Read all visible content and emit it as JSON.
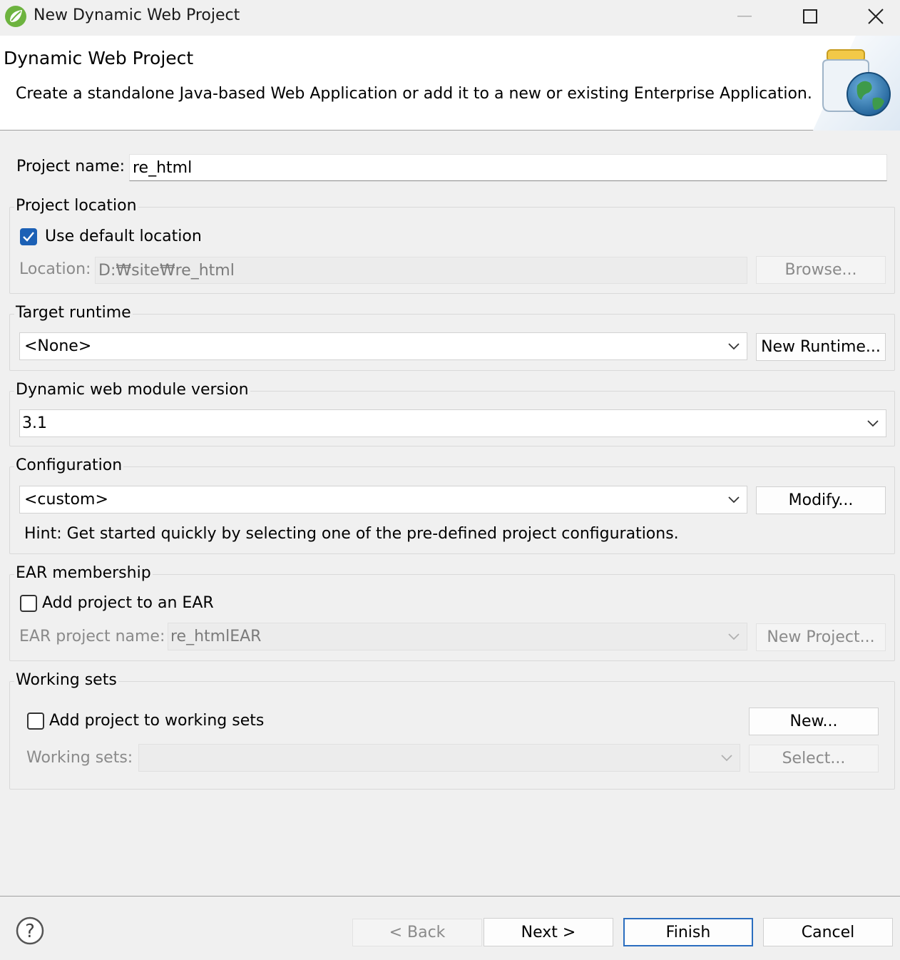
{
  "window": {
    "title": "New Dynamic Web Project",
    "minimize_icon": "minimize-icon",
    "maximize_icon": "maximize-icon",
    "close_icon": "close-icon"
  },
  "banner": {
    "title": "Dynamic Web Project",
    "description": "Create a standalone Java-based Web Application or add it to a new or existing Enterprise Application.",
    "image_icon": "jar-globe-icon"
  },
  "project_name": {
    "label": "Project name:",
    "value": "re_html"
  },
  "project_location": {
    "legend": "Project location",
    "use_default_label": "Use default location",
    "use_default_checked": true,
    "location_label": "Location:",
    "location_value": "D:₩site₩re_html",
    "browse_label": "Browse..."
  },
  "target_runtime": {
    "legend": "Target runtime",
    "selected": "<None>",
    "new_runtime_label": "New Runtime..."
  },
  "module_version": {
    "legend": "Dynamic web module version",
    "selected": "3.1"
  },
  "configuration": {
    "legend": "Configuration",
    "selected": "<custom>",
    "modify_label": "Modify...",
    "hint": "Hint: Get started quickly by selecting one of the pre-defined project configurations."
  },
  "ear_membership": {
    "legend": "EAR membership",
    "add_label": "Add project to an EAR",
    "add_checked": false,
    "ear_name_label": "EAR project name:",
    "ear_name_value": "re_htmlEAR",
    "new_project_label": "New Project..."
  },
  "working_sets": {
    "legend": "Working sets",
    "add_label": "Add project to working sets",
    "add_checked": false,
    "new_label": "New...",
    "sets_label": "Working sets:",
    "sets_value": "",
    "select_label": "Select..."
  },
  "footer": {
    "help_icon": "help-icon",
    "back_label": "< Back",
    "next_label": "Next >",
    "finish_label": "Finish",
    "cancel_label": "Cancel"
  },
  "colors": {
    "accent": "#1b60b5",
    "app_icon": "#6db33f",
    "window_bg": "#f0f0f0"
  }
}
